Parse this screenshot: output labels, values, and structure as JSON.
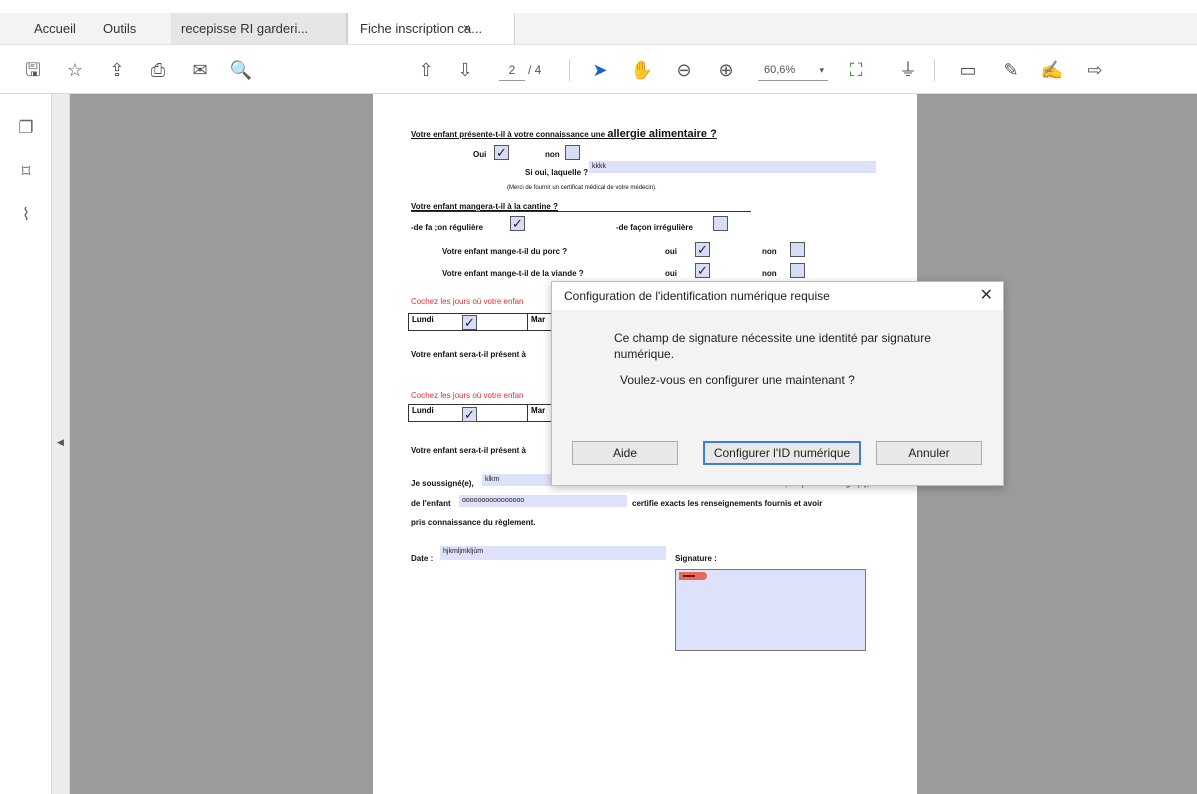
{
  "tabs": {
    "home": "Accueil",
    "tools": "Outils",
    "doc1": "recepisse RI garderi...",
    "doc2": "Fiche inscription ca...",
    "close_glyph": "×"
  },
  "toolbar": {
    "page_current": "2",
    "page_total": "/ 4",
    "zoom": "60,6%",
    "zoom_caret": "▾"
  },
  "document": {
    "allergy_q_prefix": "Votre enfant présente-t-il à votre connaissance une ",
    "allergy_q_big": "allergie alimentaire ?",
    "oui": "Oui",
    "non": "non",
    "si_oui": "Si oui, laquelle ?",
    "allergy_value": "kkkk",
    "certificat": "(Merci de fournir un certificat médical de votre médecin).",
    "cantine_q": "Votre enfant mangera-t-il à la cantine ?",
    "reguliere": "-de fa ;on régulière",
    "irreguliere": "-de façon irrégulière",
    "porc_q": "Votre enfant mange-t-il du porc ?",
    "viande_q": "Votre enfant mange-t-il de la viande ?",
    "oui_lower": "oui",
    "non_lower": "non",
    "cochez1": "Cochez les jours où votre enfan",
    "lundi": "Lundi",
    "mar": "Mar",
    "present1": "Votre enfant sera-t-il présent à",
    "cochez2": "Cochez les jours où votre enfan",
    "present2": "Votre enfant sera-t-il présent à",
    "soussigne": "Je soussigné(e),",
    "soussigne_value": "klkm",
    "responsable": ", responsable légal(e),",
    "de_enfant": "de l'enfant",
    "enfant_value": "oooooooooooooooo",
    "certifie": "certifie exacts les renseignements fournis et avoir",
    "pris": "pris connaissance du règlement.",
    "date_label": "Date :",
    "date_value": "hjkmljmkljùm",
    "signature_label": "Signature :",
    "check_glyph": "✓"
  },
  "dialog": {
    "title": "Configuration de l'identification numérique requise",
    "close": "✕",
    "message": "Ce champ de signature nécessite une identité par signature numérique.",
    "question": "Voulez-vous en configurer une maintenant ?",
    "help_button": "Aide",
    "configure_button": "Configurer l'ID numérique",
    "cancel_button": "Annuler"
  },
  "icons": {
    "save": "🖫",
    "star": "☆",
    "upload": "⇪",
    "print": "⎙",
    "mail": "✉",
    "search": "🔍",
    "up": "⇧",
    "down": "⇩",
    "pointer": "➤",
    "hand": "✋",
    "zoom_out": "⊖",
    "zoom_in": "⊕",
    "fit": "⛶",
    "measure": "⏚",
    "comment": "▭",
    "pen": "✎",
    "sign": "✍",
    "share": "⇨",
    "pages": "❐",
    "bookmark": "⌑",
    "attach": "⌇",
    "collapse": "◀"
  }
}
